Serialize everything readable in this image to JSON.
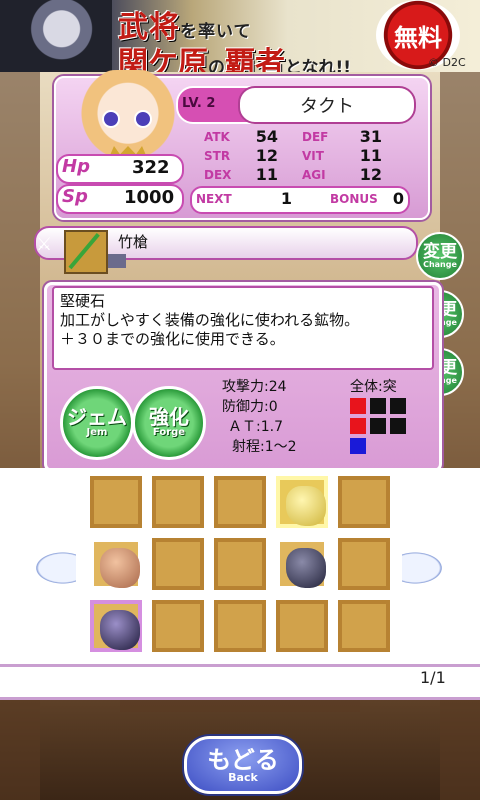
{
  "banner": {
    "line1_big": "武将",
    "line1_small": "を率いて",
    "line2_big": "関ケ原",
    "line2_small1": "の",
    "line2_big2": "覇者",
    "line2_small2": "となれ!!",
    "free": "無料",
    "copyright": "© D2C"
  },
  "character": {
    "level": "LV. 2",
    "name": "タクト",
    "hp_label": "Hp",
    "hp": "322",
    "sp_label": "Sp",
    "sp": "1000",
    "stats": [
      {
        "label": "ATK",
        "value": "54"
      },
      {
        "label": "DEF",
        "value": "31"
      },
      {
        "label": "STR",
        "value": "12"
      },
      {
        "label": "VIT",
        "value": "11"
      },
      {
        "label": "DEX",
        "value": "11"
      },
      {
        "label": "AGI",
        "value": "12"
      }
    ],
    "next_label": "NEXT",
    "next_value": "1",
    "bonus_label": "BONUS",
    "bonus_value": "0"
  },
  "equip": {
    "weapon_name": "竹槍",
    "change_jp": "変更",
    "change_en": "Change"
  },
  "item_detail": {
    "name": "堅硬石",
    "description_line1": "加工がしやすく装備の強化に使われる鉱物。",
    "description_line2": "＋３０までの強化に使用できる。",
    "gem_button_jp": "ジェム",
    "gem_button_en": "Jem",
    "forge_button_jp": "強化",
    "forge_button_en": "Forge",
    "stats": [
      {
        "label": "攻撃力",
        "value": ":24"
      },
      {
        "label": "防御力",
        "value": ":0"
      },
      {
        "label": "ＡＴ",
        "value": ":1.7"
      },
      {
        "label": "射程",
        "value": ":1～2"
      }
    ],
    "range_label": "全体:突",
    "colors": {
      "red": "#e8141c",
      "black": "#111111",
      "blue": "#1a1ad8"
    }
  },
  "inventory": {
    "page": "1/1",
    "items": [
      "yellow-stone",
      "brown-stone",
      "dark-stone",
      "dark-gem"
    ]
  },
  "back_button": {
    "jp": "もどる",
    "en": "Back"
  }
}
